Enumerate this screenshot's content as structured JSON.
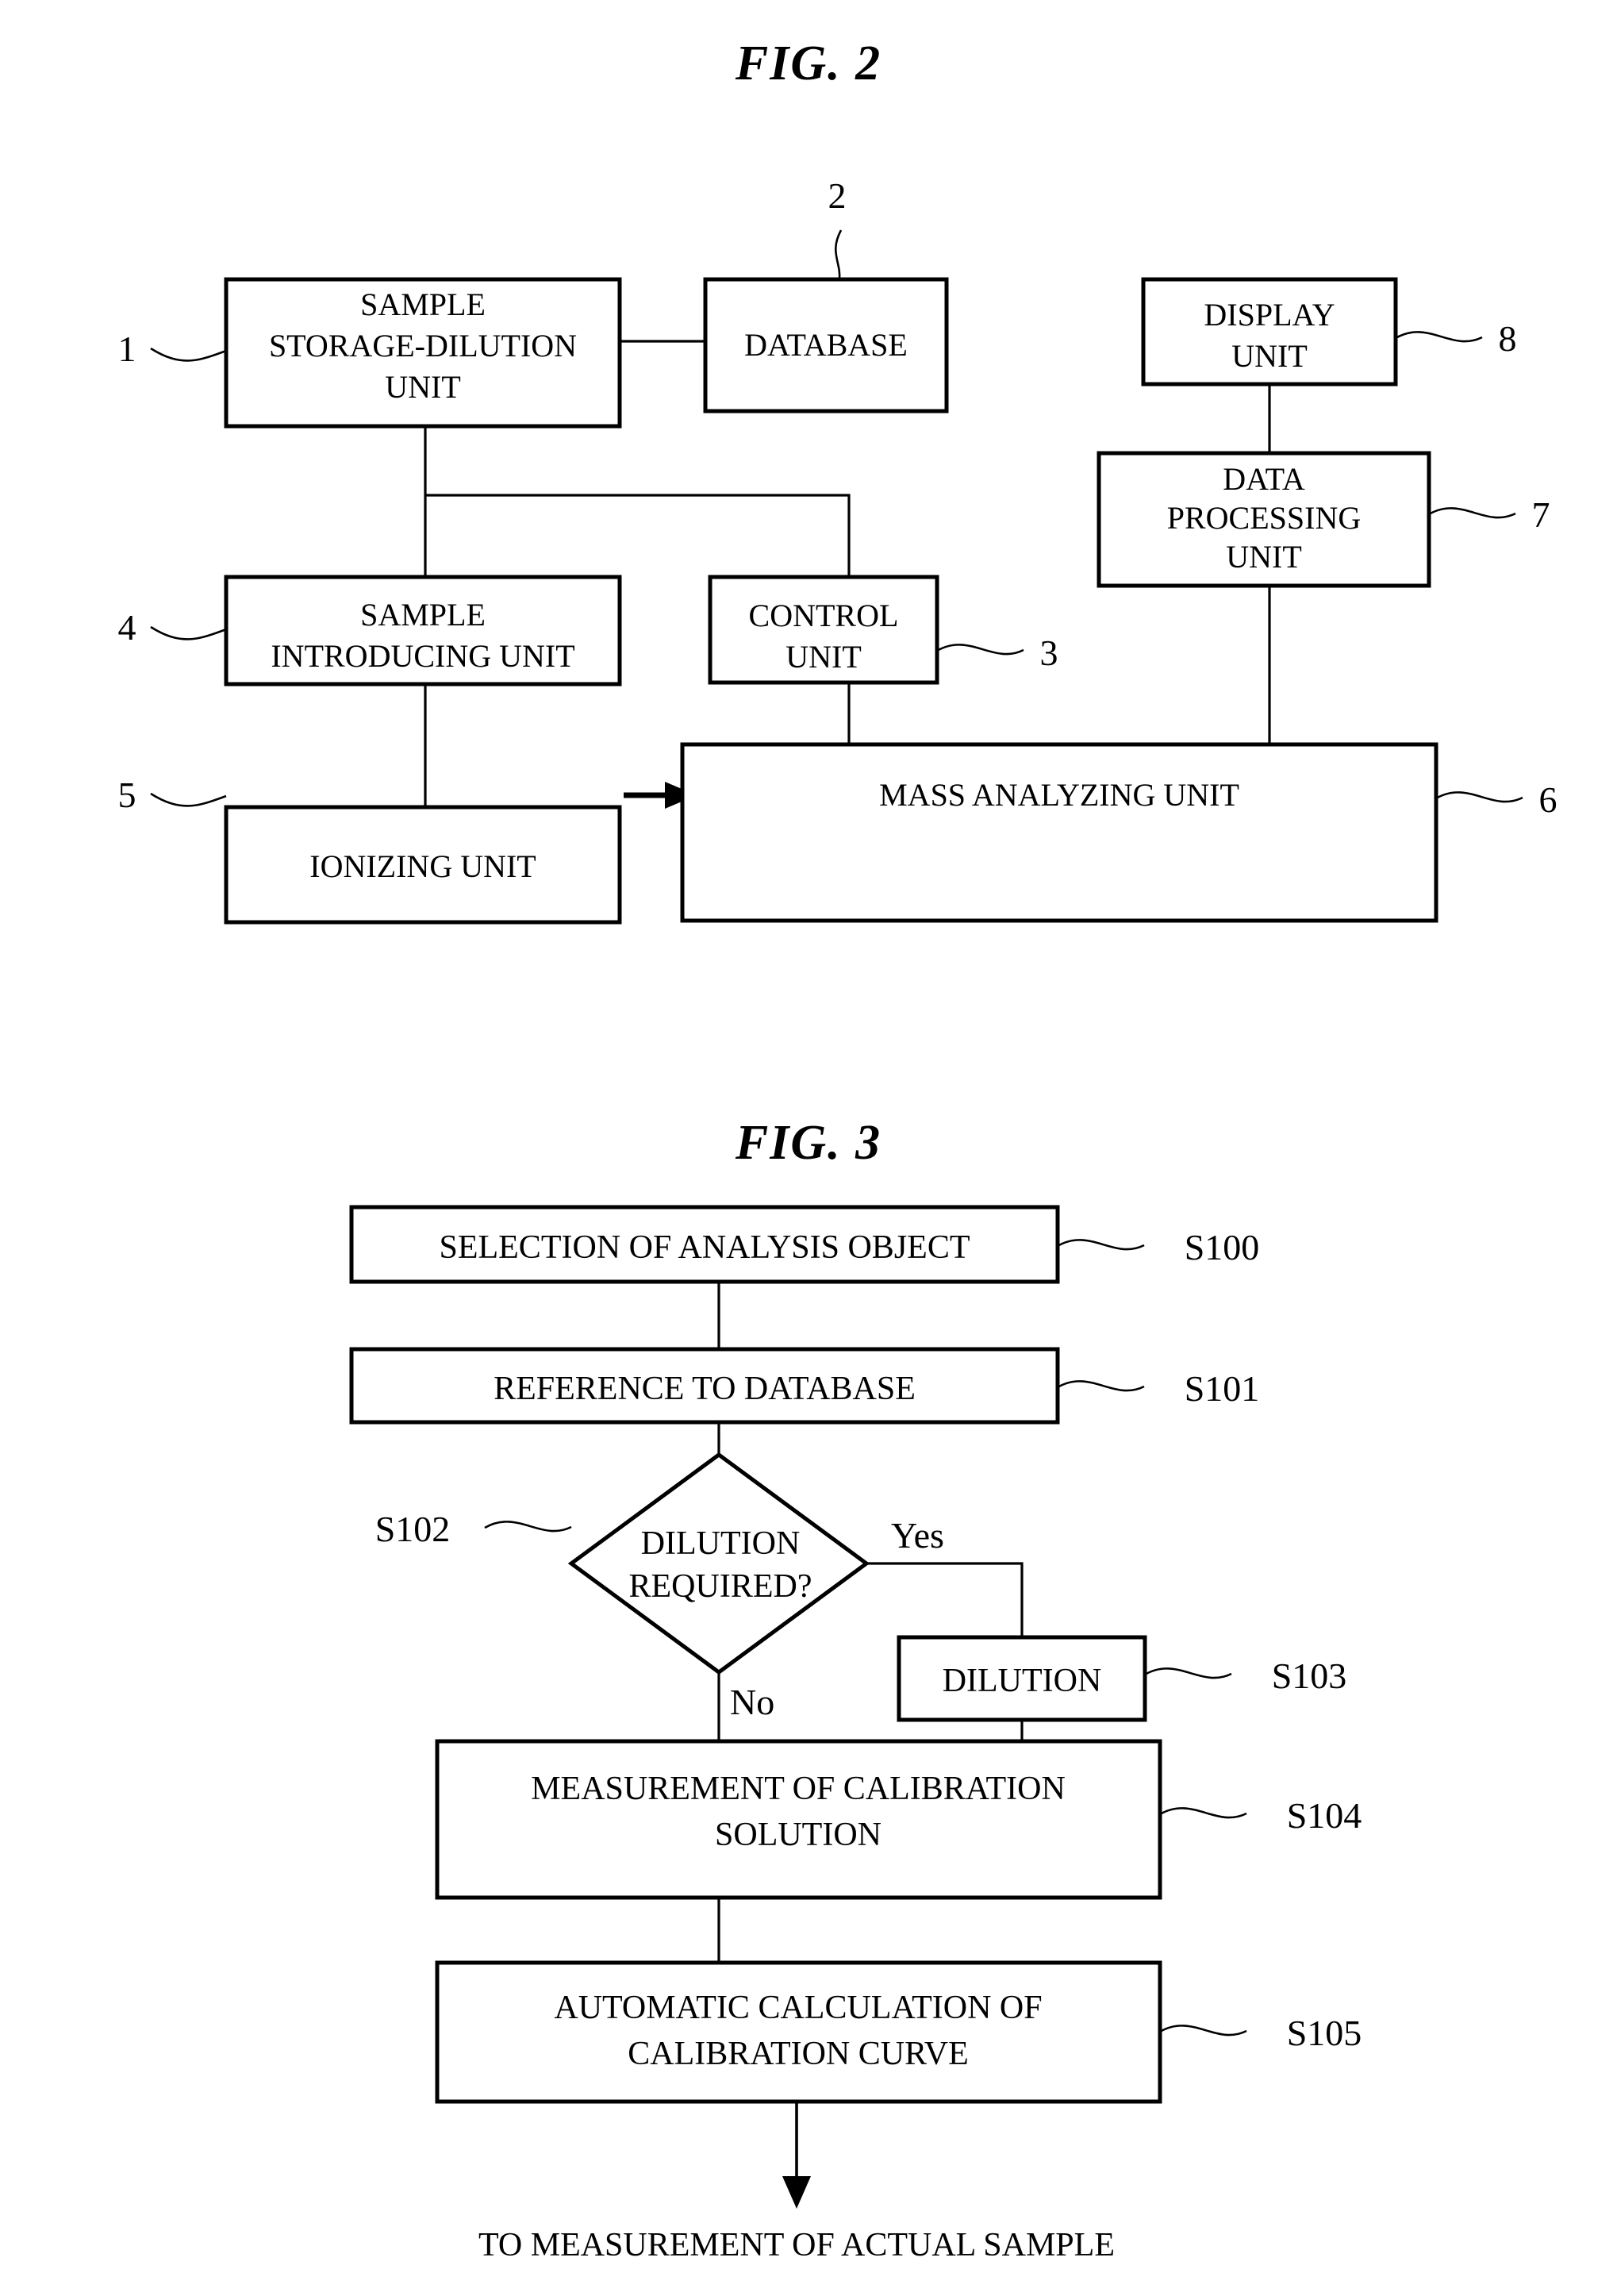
{
  "figures": [
    {
      "id": "fig2",
      "title": "FIG.  2",
      "type": "block-diagram",
      "blocks": [
        {
          "ref": "1",
          "label": "SAMPLE\nSTORAGE-DILUTION\nUNIT",
          "lines": [
            "SAMPLE",
            "STORAGE-DILUTION",
            "UNIT"
          ]
        },
        {
          "ref": "2",
          "label": "DATABASE",
          "lines": [
            "DATABASE"
          ]
        },
        {
          "ref": "8",
          "label": "DISPLAY\nUNIT",
          "lines": [
            "DISPLAY",
            "UNIT"
          ]
        },
        {
          "ref": "7",
          "label": "DATA\nPROCESSING\nUNIT",
          "lines": [
            "DATA",
            "PROCESSING",
            "UNIT"
          ]
        },
        {
          "ref": "4",
          "label": "SAMPLE\nINTRODUCING UNIT",
          "lines": [
            "SAMPLE",
            "INTRODUCING UNIT"
          ]
        },
        {
          "ref": "3",
          "label": "CONTROL\nUNIT",
          "lines": [
            "CONTROL",
            "UNIT"
          ]
        },
        {
          "ref": "5",
          "label": "IONIZING UNIT",
          "lines": [
            "IONIZING UNIT"
          ]
        },
        {
          "ref": "6",
          "label": "MASS ANALYZING UNIT",
          "lines": [
            "MASS ANALYZING UNIT"
          ]
        }
      ],
      "reference_numerals": [
        "1",
        "2",
        "3",
        "4",
        "5",
        "6",
        "7",
        "8"
      ]
    },
    {
      "id": "fig3",
      "title": "FIG.  3",
      "type": "flowchart",
      "steps": [
        {
          "ref": "S100",
          "shape": "process",
          "lines": [
            "SELECTION OF ANALYSIS OBJECT"
          ]
        },
        {
          "ref": "S101",
          "shape": "process",
          "lines": [
            "REFERENCE TO DATABASE"
          ]
        },
        {
          "ref": "S102",
          "shape": "decision",
          "lines": [
            "DILUTION",
            "REQUIRED?"
          ]
        },
        {
          "ref": "S103",
          "shape": "process",
          "lines": [
            "DILUTION"
          ]
        },
        {
          "ref": "S104",
          "shape": "process",
          "lines": [
            "MEASUREMENT OF CALIBRATION",
            "SOLUTION"
          ]
        },
        {
          "ref": "S105",
          "shape": "process",
          "lines": [
            "AUTOMATIC CALCULATION OF",
            "CALIBRATION CURVE"
          ]
        }
      ],
      "branch_labels": {
        "yes": "Yes",
        "no": "No"
      },
      "terminal_text": "TO MEASUREMENT OF ACTUAL SAMPLE",
      "reference_numerals": [
        "S100",
        "S101",
        "S102",
        "S103",
        "S104",
        "S105"
      ]
    }
  ],
  "style": {
    "ink": "#000000",
    "paper": "#ffffff"
  }
}
